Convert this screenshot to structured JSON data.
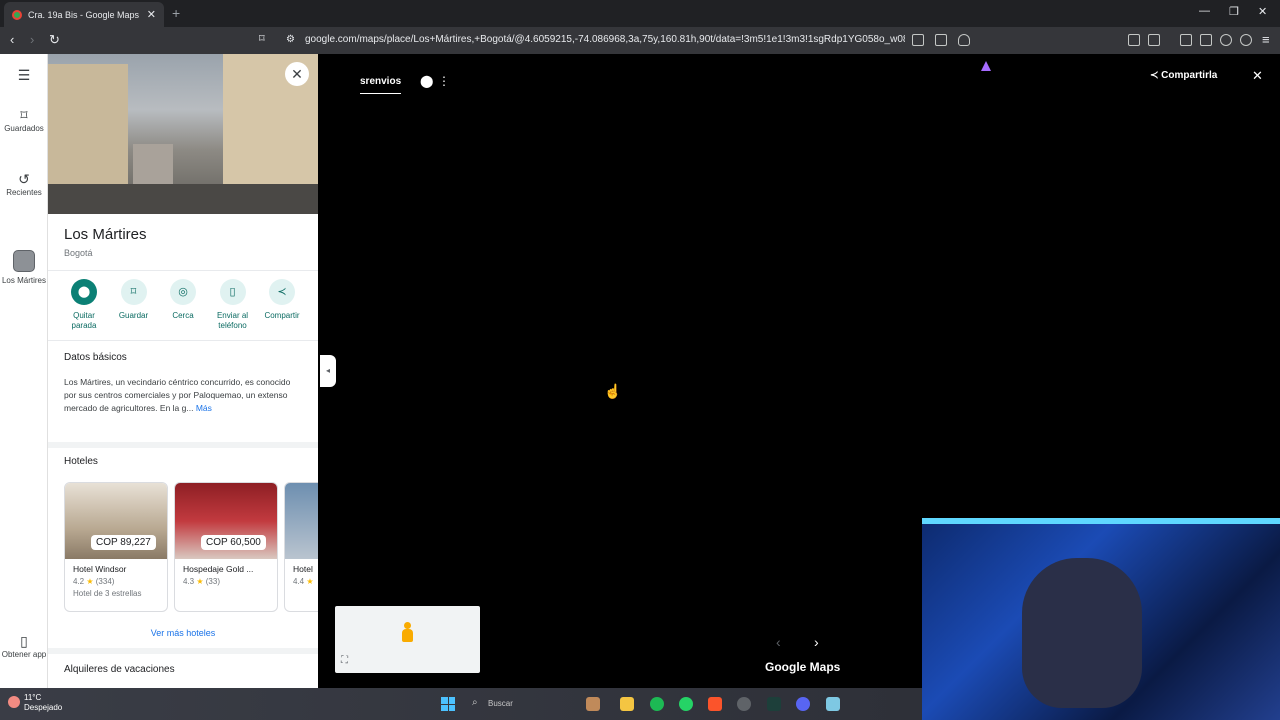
{
  "browser": {
    "tab_title": "Cra. 19a Bis - Google Maps",
    "url": "google.com/maps/place/Los+Mártires,+Bogotá/@4.6059215,-74.086968,3a,75y,160.81h,90t/data=!3m5!1e1!3m3!1sgRdp1YG058o_w08svFCJ4g!..."
  },
  "rail": {
    "menu_icon": "menu-icon",
    "saved_label": "Guardados",
    "recent_label": "Recientes",
    "place_label": "Los Mártires",
    "get_app_label": "Obtener app"
  },
  "place": {
    "title": "Los Mártires",
    "subtitle": "Bogotá",
    "actions": [
      {
        "label": "Quitar parada",
        "icon": "pin-icon"
      },
      {
        "label": "Guardar",
        "icon": "bookmark-icon"
      },
      {
        "label": "Cerca",
        "icon": "nearby-icon"
      },
      {
        "label": "Enviar al teléfono",
        "icon": "phone-icon"
      },
      {
        "label": "Compartir",
        "icon": "share-icon"
      }
    ],
    "basics_title": "Datos básicos",
    "description": "Los Mártires, un vecindario céntrico concurrido, es conocido por sus centros comerciales y por Paloquemao, un extenso mercado de agricultores. En la g...",
    "more_label": "Más",
    "hotels_title": "Hoteles",
    "hotels": [
      {
        "price": "COP 89,227",
        "name": "Hotel Windsor",
        "rating": "4.2",
        "reviews": "(334)",
        "category": "Hotel de 3 estrellas"
      },
      {
        "price": "COP 60,500",
        "name": "Hospedaje Gold ...",
        "rating": "4.3",
        "reviews": "(33)",
        "category": ""
      },
      {
        "price": "",
        "name": "Hotel",
        "rating": "4.4",
        "reviews": "",
        "category": ""
      }
    ],
    "see_more_hotels": "Ver más hoteles",
    "vacation_title": "Alquileres de vacaciones"
  },
  "streetview": {
    "label": "srenvios",
    "share_label": "Compartirla",
    "logo": "Google Maps"
  },
  "taskbar": {
    "temperature": "11°C",
    "weather": "Despejado",
    "search_label": "Buscar"
  },
  "colors": {
    "accent": "#0b8075",
    "link": "#1a73e8",
    "star": "#fbbc04"
  }
}
